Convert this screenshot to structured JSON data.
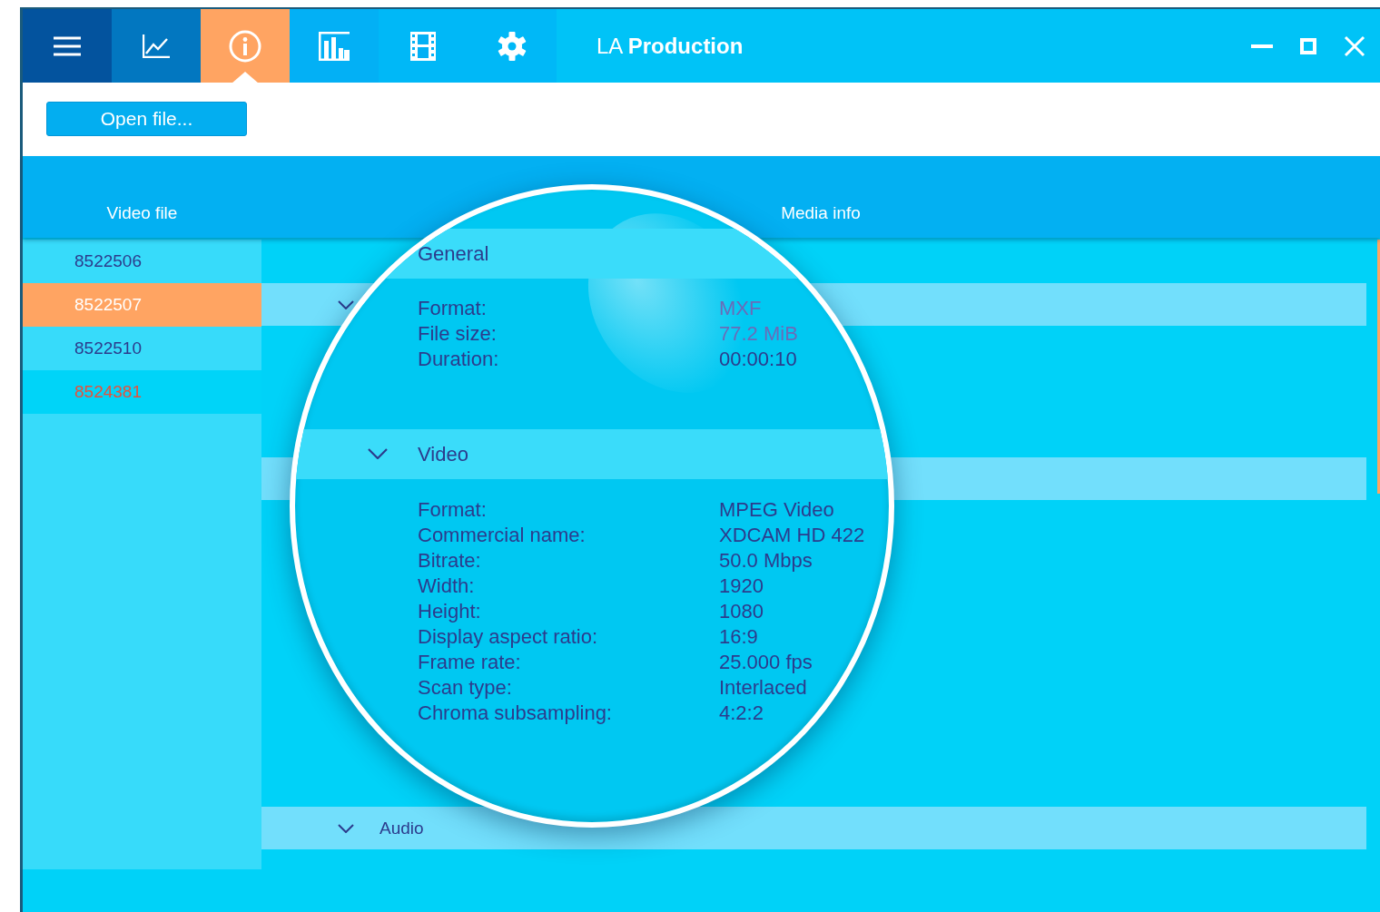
{
  "toolbar_tabs": [
    {
      "kind": "menu",
      "selected": false
    },
    {
      "kind": "chart",
      "selected": false
    },
    {
      "kind": "info",
      "selected": true
    },
    {
      "kind": "bars",
      "selected": false
    },
    {
      "kind": "film",
      "selected": false
    },
    {
      "kind": "settings",
      "selected": false
    }
  ],
  "window": {
    "title_prefix": "LA",
    "title_name": "Production"
  },
  "open_button": "Open file...",
  "columns": [
    "Video file",
    "Media info"
  ],
  "files": [
    {
      "name": "8522506",
      "selected": false
    },
    {
      "name": "8522507",
      "selected": true
    },
    {
      "name": "8522510",
      "selected": false
    },
    {
      "name": "8524381",
      "selected": false,
      "color": "#e8503a"
    }
  ],
  "media_info": {
    "sections": [
      {
        "kind": "header",
        "expanded": true
      },
      {
        "kind": "plain"
      },
      {
        "kind": "header",
        "title": "Audio",
        "expanded": true
      }
    ]
  },
  "magnifier": {
    "sections": [
      {
        "title": "General",
        "fields": [
          {
            "label": "Format:",
            "value": "MXF",
            "faded": true
          },
          {
            "label": "File size:",
            "value": "77.2 MiB",
            "faded": true
          },
          {
            "label": "Duration:",
            "value": "00:00:10",
            "faded": false
          }
        ]
      },
      {
        "title": "Video",
        "expanded": true,
        "fields": [
          {
            "label": "Format:",
            "value": "MPEG Video",
            "faded": false
          },
          {
            "label": "Commercial name:",
            "value": "XDCAM HD 422",
            "faded": false
          },
          {
            "label": "Bitrate:",
            "value": "50.0 Mbps",
            "faded": false
          },
          {
            "label": "Width:",
            "value": "1920",
            "faded": false
          },
          {
            "label": "Height:",
            "value": "1080",
            "faded": false
          },
          {
            "label": "Display aspect ratio:",
            "value": "16:9",
            "faded": false
          },
          {
            "label": "Frame rate:",
            "value": "25.000 fps",
            "faded": false
          },
          {
            "label": "Scan type:",
            "value": "Interlaced",
            "faded": false
          },
          {
            "label": "Chroma subsampling:",
            "value": "4:2:2",
            "faded": false
          }
        ]
      }
    ]
  }
}
